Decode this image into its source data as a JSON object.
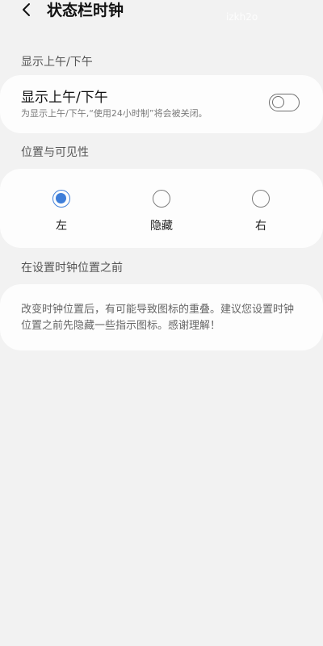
{
  "header": {
    "title": "状态栏时钟",
    "watermark": "izkh2o"
  },
  "ampm_section": {
    "label": "显示上午/下午",
    "row_title": "显示上午/下午",
    "row_subtitle": "为显示上午/下午,“使用24小时制”将会被关闭。",
    "toggle_on": false
  },
  "position_section": {
    "label": "位置与可见性",
    "options": [
      {
        "label": "左",
        "selected": true
      },
      {
        "label": "隐藏",
        "selected": false
      },
      {
        "label": "右",
        "selected": false
      }
    ]
  },
  "note_section": {
    "label": "在设置时钟位置之前",
    "text": "改变时钟位置后，有可能导致图标的重叠。建议您设置时钟位置之前先隐藏一些指示图标。感谢理解！"
  },
  "colors": {
    "background": "#f2f2f2",
    "card": "#fdfdfd",
    "accent": "#3e7ed9"
  },
  "icons": {
    "back": "chevron-left-icon"
  }
}
